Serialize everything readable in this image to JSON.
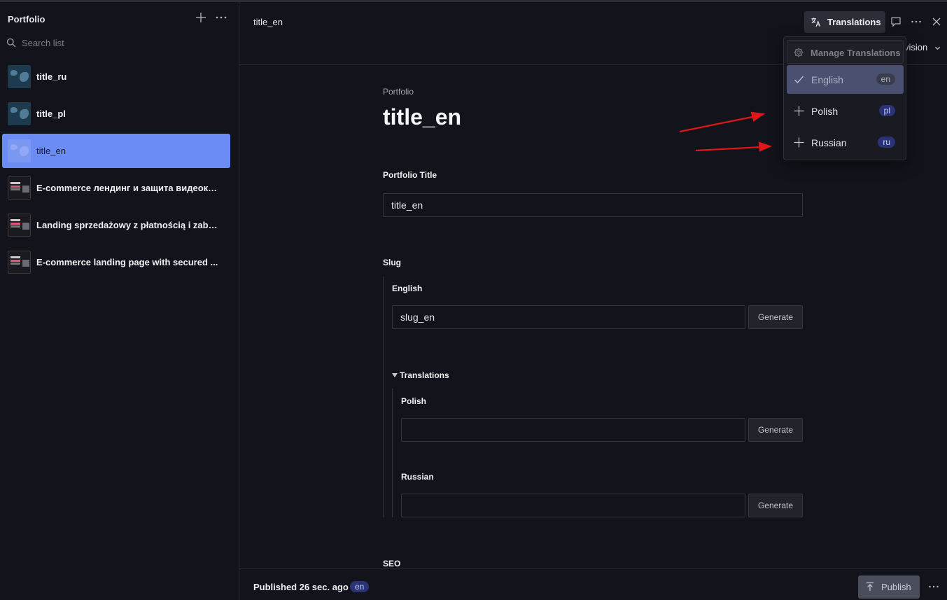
{
  "sidebar": {
    "title": "Portfolio",
    "search_placeholder": "Search list",
    "items": [
      {
        "label": "title_ru",
        "thumb": "map"
      },
      {
        "label": "title_pl",
        "thumb": "map"
      },
      {
        "label": "title_en",
        "thumb": "map",
        "active": true
      },
      {
        "label": "E-commerce лендинг и защита видеоку...",
        "thumb": "site"
      },
      {
        "label": "Landing sprzedażowy z płatnością i zabe...",
        "thumb": "site"
      },
      {
        "label": "E-commerce landing page with secured ...",
        "thumb": "site"
      }
    ]
  },
  "header": {
    "doc_title": "title_en",
    "translations_label": "Translations",
    "revision_label": "vision"
  },
  "translations_menu": {
    "manage_label": "Manage Translations",
    "languages": [
      {
        "label": "English",
        "code": "en",
        "selected": true
      },
      {
        "label": "Polish",
        "code": "pl"
      },
      {
        "label": "Russian",
        "code": "ru"
      }
    ]
  },
  "document": {
    "breadcrumb": "Portfolio",
    "title": "title_en",
    "portfolio_title_label": "Portfolio Title",
    "portfolio_title_value": "title_en",
    "slug_label": "Slug",
    "slug_english_label": "English",
    "slug_english_value": "slug_en",
    "generate_label": "Generate",
    "translations_toggle": "Translations",
    "slug_polish_label": "Polish",
    "slug_polish_value": "",
    "slug_russian_label": "Russian",
    "slug_russian_value": "",
    "seo_label": "SEO"
  },
  "footer": {
    "status": "Published 26 sec. ago",
    "lang": "en",
    "publish_label": "Publish"
  },
  "colors": {
    "background": "#13141b",
    "active_item": "#6c8cf5",
    "annotation_arrow": "#e0161b"
  }
}
